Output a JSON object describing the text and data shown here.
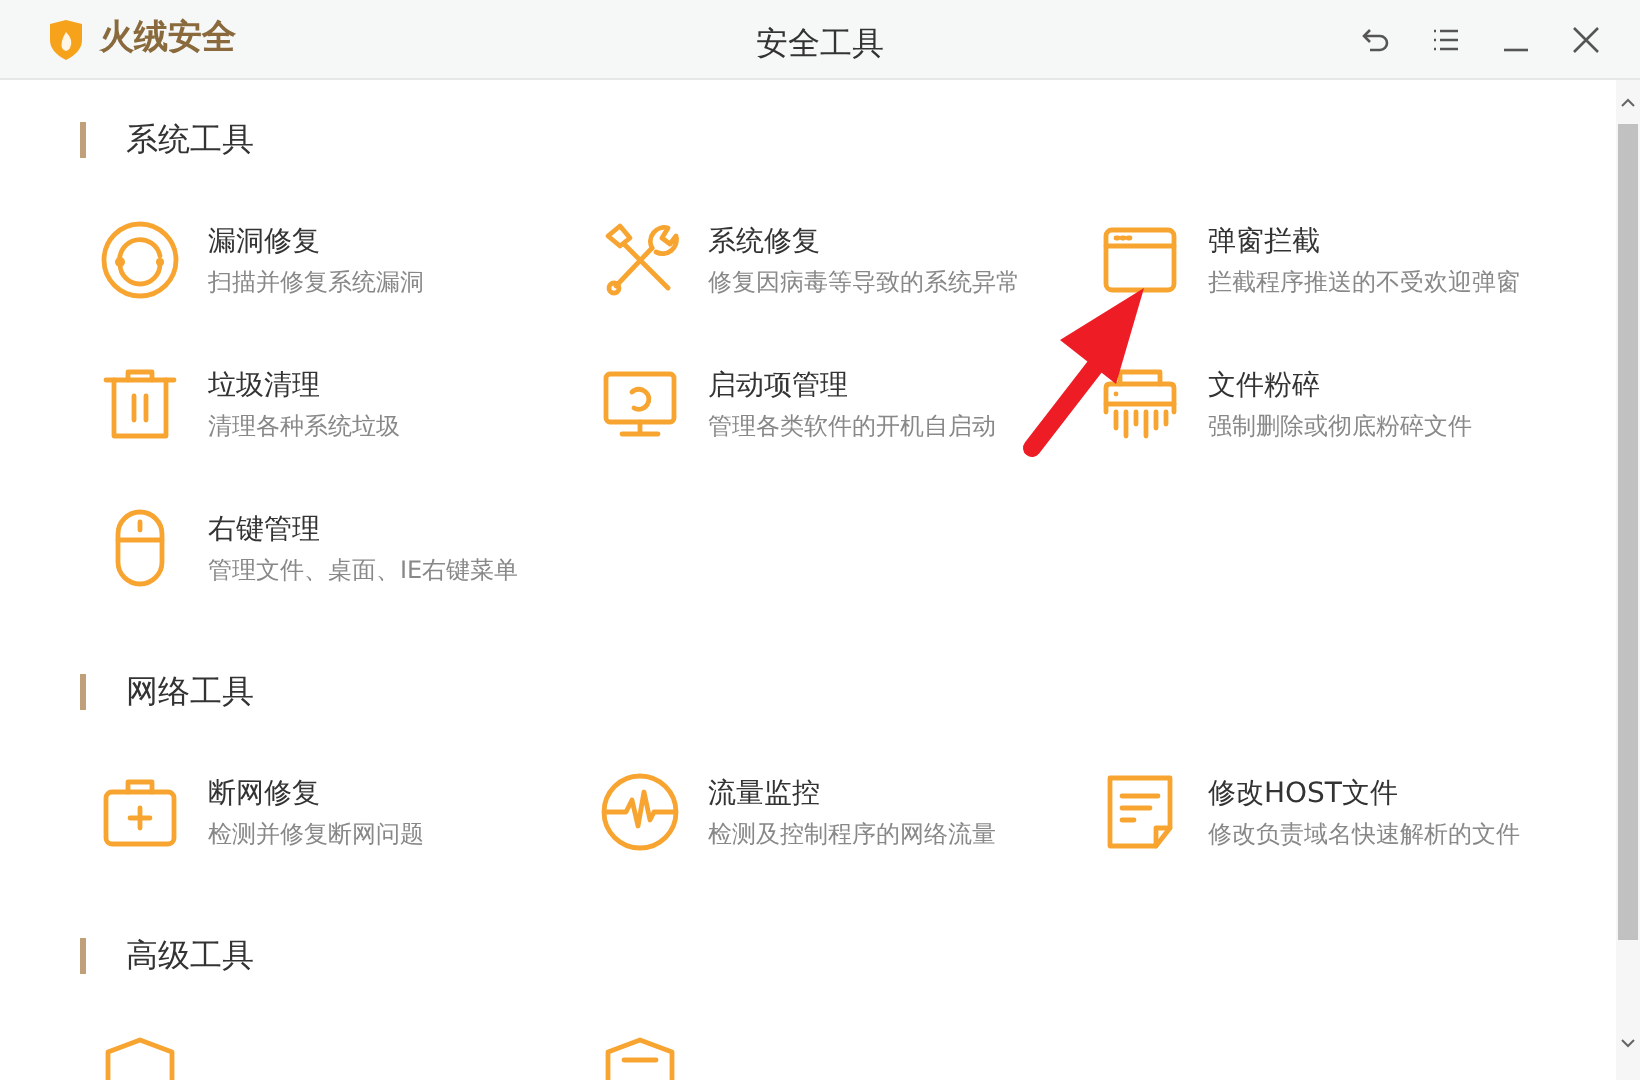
{
  "window": {
    "app_name": "火绒安全",
    "title": "安全工具"
  },
  "sections": [
    {
      "title": "系统工具",
      "tools": [
        {
          "name": "漏洞修复",
          "description": "扫描并修复系统漏洞"
        },
        {
          "name": "系统修复",
          "description": "修复因病毒等导致的系统异常"
        },
        {
          "name": "弹窗拦截",
          "description": "拦截程序推送的不受欢迎弹窗"
        },
        {
          "name": "垃圾清理",
          "description": "清理各种系统垃圾"
        },
        {
          "name": "启动项管理",
          "description": "管理各类软件的开机自启动"
        },
        {
          "name": "文件粉碎",
          "description": "强制删除或彻底粉碎文件"
        },
        {
          "name": "右键管理",
          "description": "管理文件、桌面、IE右键菜单"
        }
      ]
    },
    {
      "title": "网络工具",
      "tools": [
        {
          "name": "断网修复",
          "description": "检测并修复断网问题"
        },
        {
          "name": "流量监控",
          "description": "检测及控制程序的网络流量"
        },
        {
          "name": "修改HOST文件",
          "description": "修改负责域名快速解析的文件"
        }
      ]
    },
    {
      "title": "高级工具",
      "tools": [
        {
          "kind": "cut_off"
        },
        {
          "kind": "cut_off"
        }
      ]
    }
  ]
}
